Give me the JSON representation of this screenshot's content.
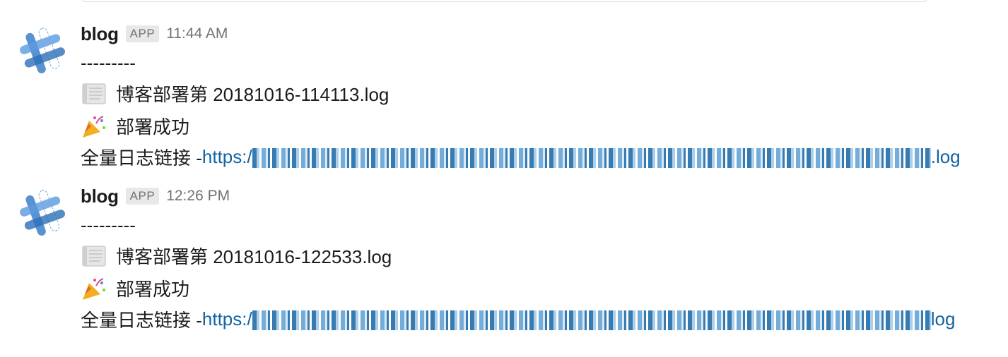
{
  "messages": [
    {
      "sender": "blog",
      "badge": "APP",
      "time": "11:44 AM",
      "divider": "---------",
      "file_line": "博客部署第 20181016-114113.log",
      "status_line": "部署成功",
      "log_label": "全量日志链接 - ",
      "link_prefix": "https:/",
      "link_suffix": ".log",
      "file_icon": "scroll-icon",
      "status_icon": "party-popper-icon"
    },
    {
      "sender": "blog",
      "badge": "APP",
      "time": "12:26 PM",
      "divider": "---------",
      "file_line": "博客部署第 20181016-122533.log",
      "status_line": "部署成功",
      "log_label": "全量日志链接 - ",
      "link_prefix": "https:/",
      "link_suffix": "log",
      "file_icon": "scroll-icon",
      "status_icon": "party-popper-icon"
    }
  ],
  "colors": {
    "link": "#1264a3",
    "meta": "#717274",
    "text": "#1d1c1d"
  }
}
